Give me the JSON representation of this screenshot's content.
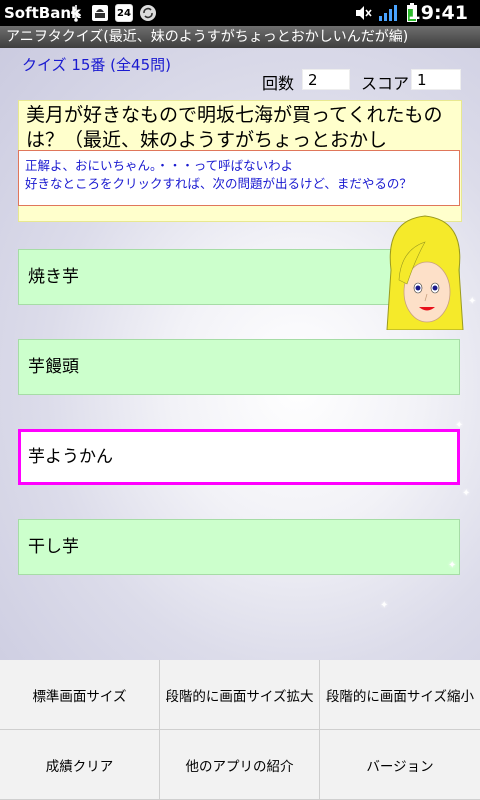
{
  "status": {
    "carrier": "SoftBank",
    "time": "19:41",
    "notif_number": "24"
  },
  "app": {
    "title": "アニヲタクイズ(最近、妹のようすがちょっとおかしいんだが編)"
  },
  "quiz": {
    "number_label": "クイズ 15番 (全45問)",
    "count_label": "回数",
    "count_value": "2",
    "score_label": "スコア",
    "score_value": "1",
    "question": "美月が好きなもので明坂七海が買ってくれたものは？（最近、妹のようすがちょっとおかし",
    "answer_line1": "正解よ、おにいちゃん。・・・って呼ばないわよ",
    "answer_line2": "好きなところをクリックすれば、次の問題が出るけど、まだやるの？",
    "choices": [
      "焼き芋",
      "芋饅頭",
      "芋ようかん",
      "干し芋"
    ],
    "selected_index": 2
  },
  "menu": {
    "items": [
      "標準画面サイズ",
      "段階的に画面サイズ拡大",
      "段階的に画面サイズ縮小",
      "成績クリア",
      "他のアプリの紹介",
      "バージョン"
    ]
  },
  "colors": {
    "question_bg": "#ffffcc",
    "choice_bg": "#ccffcc",
    "selected_border": "#ff00ff",
    "accent_blue": "#1a1ad0"
  }
}
